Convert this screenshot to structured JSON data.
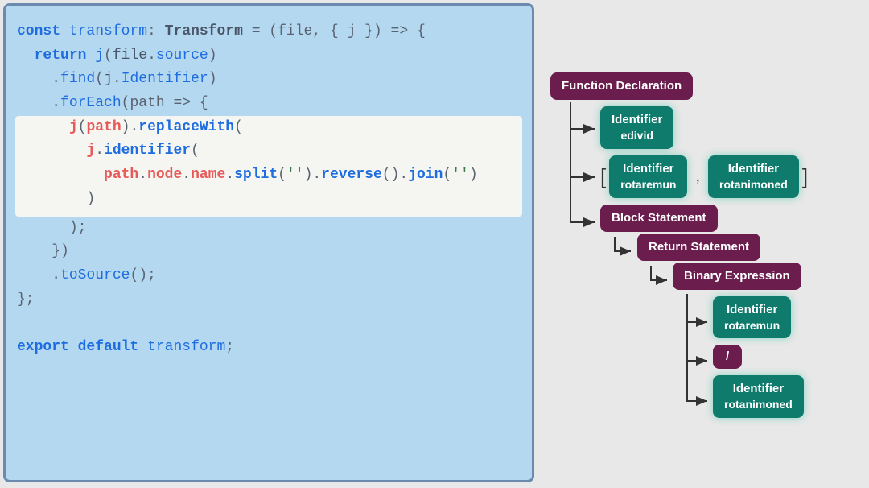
{
  "code": {
    "l1": {
      "kw1": "const",
      "name": "transform",
      "colon": ":",
      "type": "Transform",
      "eq": " = ",
      "params": "(file, { j })",
      "arrow": " => {"
    },
    "l2": {
      "kw": "return",
      "call": "j",
      "open": "(",
      "obj": "file",
      "dot": ".",
      "prop": "source",
      "close": ")"
    },
    "l3": {
      "dot": ".",
      "method": "find",
      "open": "(",
      "obj": "j",
      "dot2": ".",
      "prop": "Identifier",
      "close": ")"
    },
    "l4": {
      "dot": ".",
      "method": "forEach",
      "open": "(",
      "param": "path",
      "arrow": " => {"
    },
    "l5": {
      "j": "j",
      "open": "(",
      "path": "path",
      "close": ").",
      "method": "replaceWith",
      "open2": "("
    },
    "l6": {
      "j": "j",
      "dot": ".",
      "method": "identifier",
      "open": "("
    },
    "l7": {
      "chain": "path.node.name.split",
      "s1": "('')",
      "rev": ".reverse()",
      "join": ".join",
      "s2": "('')"
    },
    "l8": {
      "close": ")"
    },
    "l9": {
      "close": ");"
    },
    "l10": {
      "close": "})"
    },
    "l11": {
      "dot": ".",
      "method": "toSource",
      "call": "();"
    },
    "l12": {
      "close": "};"
    },
    "l13": {
      "kw1": "export",
      "kw2": "default",
      "name": "transform",
      "semi": ";"
    }
  },
  "tree": {
    "n1": "Function Declaration",
    "n2": {
      "t": "Identifier",
      "s": "edivid"
    },
    "bracket_open": "[",
    "n3": {
      "t": "Identifier",
      "s": "rotaremun"
    },
    "comma": ",",
    "n4": {
      "t": "Identifier",
      "s": "rotanimoned"
    },
    "bracket_close": "]",
    "n5": "Block Statement",
    "n6": "Return Statement",
    "n7": "Binary Expression",
    "n8": {
      "t": "Identifier",
      "s": "rotaremun"
    },
    "n9": "/",
    "n10": {
      "t": "Identifier",
      "s": "rotanimoned"
    }
  }
}
